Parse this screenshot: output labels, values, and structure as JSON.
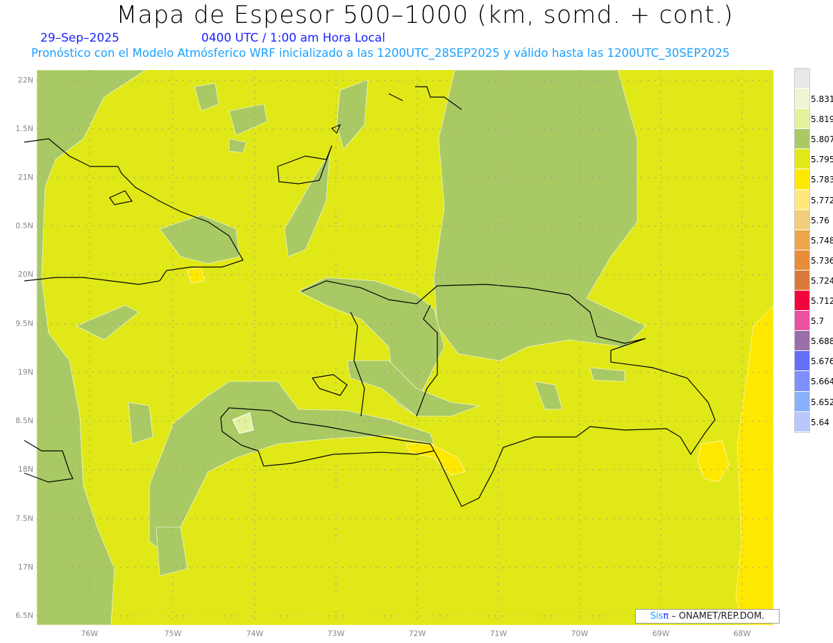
{
  "header": {
    "title": "Mapa de Espesor 500–1000 (km, somd. + cont.)",
    "date": "29–Sep–2025",
    "time": "0400 UTC / 1:00 am Hora Local",
    "subtitle": "Pronóstico con el Modelo Atmósferico WRF inicializado a las 1200UTC_28SEP2025 y válido hasta las  1200UTC_30SEP2025"
  },
  "lat_labels": [
    "22N",
    "1.5N",
    "21N",
    "0.5N",
    "20N",
    "9.5N",
    "19N",
    "8.5N",
    "18N",
    "7.5N",
    "17N",
    "6.5N"
  ],
  "lon_labels": [
    "76W",
    "75W",
    "74W",
    "73W",
    "72W",
    "71W",
    "70W",
    "69W",
    "68W"
  ],
  "colorbar": {
    "levels": [
      "5.831",
      "5.819",
      "5.807",
      "5.795",
      "5.783",
      "5.772",
      "5.76",
      "5.748",
      "5.736",
      "5.724",
      "5.712",
      "5.7",
      "5.688",
      "5.676",
      "5.664",
      "5.652",
      "5.64"
    ],
    "colors": [
      "#e8e8e8",
      "#eef5d2",
      "#e2f29c",
      "#a9c964",
      "#e0e817",
      "#ffe800",
      "#ffe87a",
      "#f2cd7a",
      "#eca54a",
      "#e78c38",
      "#d97a3a",
      "#f0053c",
      "#ea52a0",
      "#9a6ea8",
      "#6470f8",
      "#7e90fc",
      "#88b0fc",
      "#b8c8fc"
    ]
  },
  "credit": {
    "sis": "Sis",
    "pi": "π",
    "rest": " –  ONAMET/REP.DOM."
  },
  "colors": {
    "base": "#e0e817",
    "green": "#a9c964",
    "yellow": "#ffe800",
    "light": "#e2f29c",
    "orange": "#ffe87a"
  }
}
